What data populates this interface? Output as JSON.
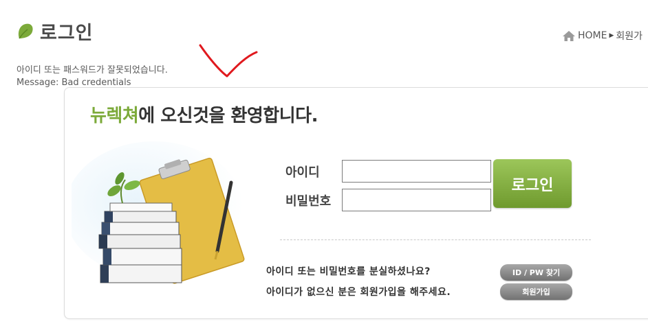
{
  "page": {
    "title": "로그인",
    "breadcrumb": {
      "home": "HOME",
      "current": "회원가"
    }
  },
  "error": {
    "line1": "아이디 또는 패스워드가 잘못되었습니다.",
    "line2": "Message: Bad credentials"
  },
  "login": {
    "welcome_brand": "뉴렉쳐",
    "welcome_rest": "에 오신것을 환영합니다.",
    "id_label": "아이디",
    "pw_label": "비밀번호",
    "id_value": "",
    "pw_value": "",
    "submit_label": "로그인",
    "help_find": "아이디 또는 비밀번호를 분실하셨나요?",
    "find_button": "ID / PW 찾기",
    "help_join": "아이디가 없으신 분은 회원가입을 해주세요.",
    "join_button": "회원가입"
  },
  "colors": {
    "brand_green": "#7caa3a",
    "annotation_red": "#e0191e"
  }
}
